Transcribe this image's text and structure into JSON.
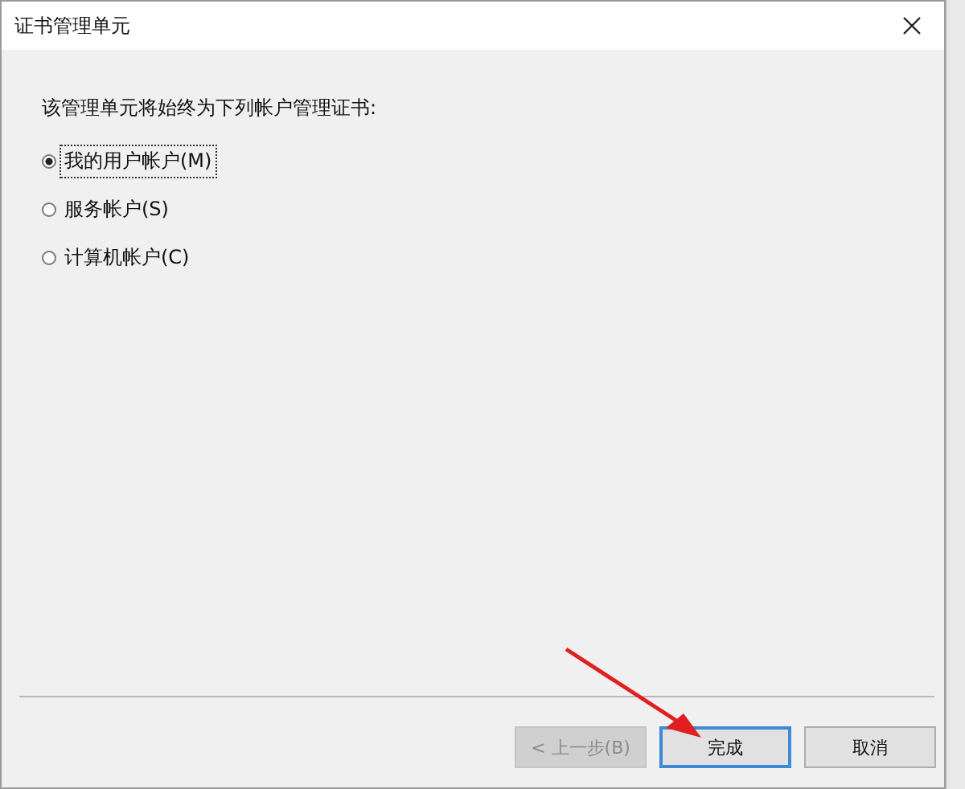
{
  "window": {
    "title": "证书管理单元"
  },
  "prompt": "该管理单元将始终为下列帐户管理证书:",
  "options": [
    {
      "label": "我的用户帐户(M)",
      "selected": true
    },
    {
      "label": "服务帐户(S)",
      "selected": false
    },
    {
      "label": "计算机帐户(C)",
      "selected": false
    }
  ],
  "buttons": [
    {
      "label": "< 上一步(B)",
      "disabled": true,
      "default": false
    },
    {
      "label": "完成",
      "disabled": false,
      "default": true
    },
    {
      "label": "取消",
      "disabled": false,
      "default": false
    }
  ]
}
